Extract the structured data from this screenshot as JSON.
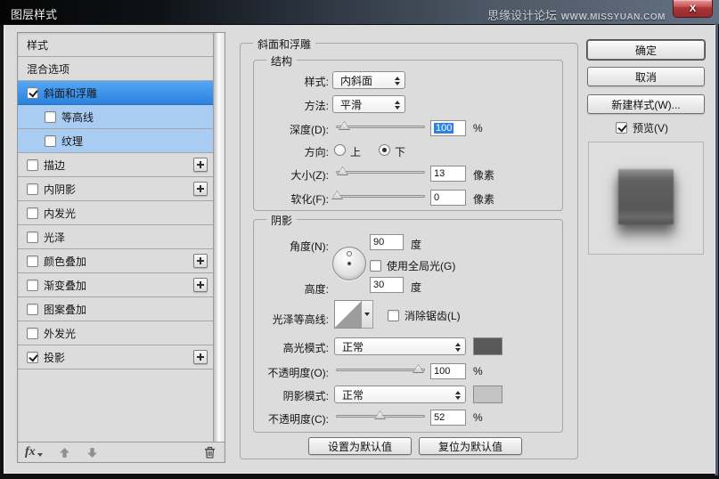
{
  "window": {
    "title": "图层样式",
    "watermark_name": "思缘设计论坛",
    "watermark_site": "WWW.MISSYUAN.COM",
    "close_glyph": "X"
  },
  "colors": {
    "selected_row": "#3e97ee",
    "sub_row": "#a9ccf2",
    "highlight_swatch": "#595959",
    "shadow_swatch": "#c4c4c4",
    "value_selection": "#2f83e0"
  },
  "sidebar": {
    "items": [
      {
        "label": "样式",
        "checkbox": null,
        "state": "normal",
        "plus": false
      },
      {
        "label": "混合选项",
        "checkbox": null,
        "state": "normal",
        "plus": false
      },
      {
        "label": "斜面和浮雕",
        "checkbox": true,
        "state": "selected",
        "plus": false
      },
      {
        "label": "等高线",
        "checkbox": false,
        "state": "sub",
        "plus": false
      },
      {
        "label": "纹理",
        "checkbox": false,
        "state": "sub",
        "plus": false
      },
      {
        "label": "描边",
        "checkbox": false,
        "state": "normal",
        "plus": true
      },
      {
        "label": "内阴影",
        "checkbox": false,
        "state": "normal",
        "plus": true
      },
      {
        "label": "内发光",
        "checkbox": false,
        "state": "normal",
        "plus": false
      },
      {
        "label": "光泽",
        "checkbox": false,
        "state": "normal",
        "plus": false
      },
      {
        "label": "颜色叠加",
        "checkbox": false,
        "state": "normal",
        "plus": true
      },
      {
        "label": "渐变叠加",
        "checkbox": false,
        "state": "normal",
        "plus": true
      },
      {
        "label": "图案叠加",
        "checkbox": false,
        "state": "normal",
        "plus": false
      },
      {
        "label": "外发光",
        "checkbox": false,
        "state": "normal",
        "plus": false
      },
      {
        "label": "投影",
        "checkbox": true,
        "state": "normal",
        "plus": true
      }
    ],
    "toolbar": {
      "fx_label": "fx"
    }
  },
  "panel": {
    "title": "斜面和浮雕",
    "structure": {
      "title": "结构",
      "style_label": "样式:",
      "style_value": "内斜面",
      "method_label": "方法:",
      "method_value": "平滑",
      "depth_label": "深度(D):",
      "depth_value": "100",
      "depth_unit": "%",
      "depth_percent": 10,
      "direction_label": "方向:",
      "up_label": "上",
      "down_label": "下",
      "up_selected": false,
      "down_selected": true,
      "size_label": "大小(Z):",
      "size_value": "13",
      "size_unit": "像素",
      "size_percent": 8,
      "soften_label": "软化(F):",
      "soften_value": "0",
      "soften_unit": "像素",
      "soften_percent": 2
    },
    "shading": {
      "title": "阴影",
      "angle_label": "角度(N):",
      "angle_value": "90",
      "angle_unit": "度",
      "global_light_label": "使用全局光(G)",
      "global_light_checked": false,
      "altitude_label": "高度:",
      "altitude_value": "30",
      "altitude_unit": "度",
      "gloss_label": "光泽等高线:",
      "antialias_label": "消除锯齿(L)",
      "antialias_checked": false,
      "highlight_mode_label": "高光模式:",
      "highlight_mode_value": "正常",
      "highlight_color": "#595959",
      "opacity_high_label": "不透明度(O):",
      "opacity_high_value": "100",
      "opacity_high_unit": "%",
      "opacity_high_percent": 93,
      "shadow_mode_label": "阴影模式:",
      "shadow_mode_value": "正常",
      "shadow_color": "#c4c4c4",
      "opacity_shadow_label": "不透明度(C):",
      "opacity_shadow_value": "52",
      "opacity_shadow_unit": "%",
      "opacity_shadow_percent": 50
    },
    "footer": {
      "make_default": "设置为默认值",
      "reset_default": "复位为默认值"
    }
  },
  "actions": {
    "ok": "确定",
    "cancel": "取消",
    "new_style": "新建样式(W)...",
    "preview_label": "预览(V)",
    "preview_checked": true
  }
}
